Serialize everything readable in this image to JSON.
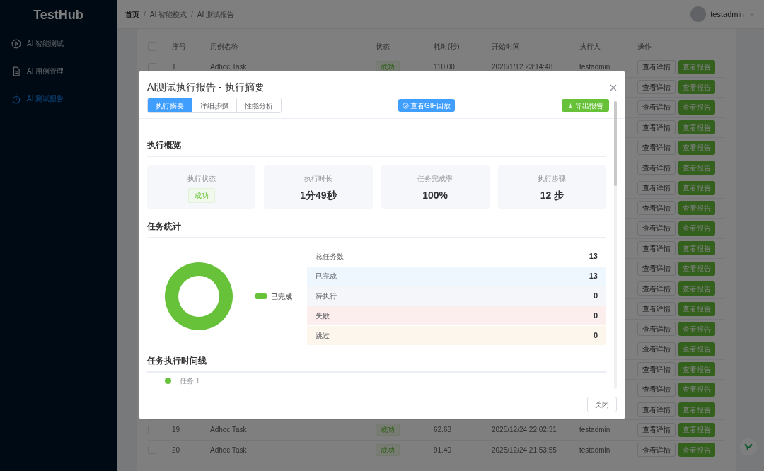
{
  "sidebar": {
    "logo": "TestHub",
    "items": [
      {
        "label": "AI 智能测试",
        "selected": false
      },
      {
        "label": "AI 用例管理",
        "selected": false
      },
      {
        "label": "AI 测试报告",
        "selected": true
      }
    ]
  },
  "header": {
    "breadcrumb": [
      "首页",
      "AI 智能模式",
      "AI 测试报告"
    ],
    "separator": "/",
    "user": "testadmin"
  },
  "table": {
    "all_checked": false,
    "columns": [
      "序号",
      "用例名称",
      "状态",
      "耗时(秒)",
      "开始时间",
      "执行人",
      "操作"
    ],
    "rows": [
      {
        "checked": false,
        "cells": [
          "1",
          "Adhoc Task",
          "成功",
          "110.00",
          "2026/1/12 23:14:48",
          "testadmin"
        ],
        "actions": [
          "查看详情",
          "查看报告"
        ]
      },
      {
        "actions": [
          "查看详情",
          "查看报告"
        ]
      },
      {
        "actions": [
          "查看详情",
          "查看报告"
        ]
      },
      {
        "actions": [
          "查看详情",
          "查看报告"
        ]
      },
      {
        "actions": [
          "查看详情",
          "查看报告"
        ]
      },
      {
        "actions": [
          "查看详情",
          "查看报告"
        ]
      },
      {
        "actions": [
          "查看详情",
          "查看报告"
        ]
      },
      {
        "actions": [
          "查看详情",
          "查看报告"
        ]
      },
      {
        "actions": [
          "查看详情",
          "查看报告"
        ]
      },
      {
        "actions": [
          "查看详情",
          "查看报告"
        ]
      },
      {
        "actions": [
          "查看详情",
          "查看报告"
        ]
      },
      {
        "actions": [
          "查看详情",
          "查看报告"
        ]
      },
      {
        "actions": [
          "查看详情",
          "查看报告"
        ]
      },
      {
        "actions": [
          "查看详情",
          "查看报告"
        ]
      },
      {
        "actions": [
          "查看详情",
          "查看报告"
        ]
      },
      {
        "actions": [
          "查看详情",
          "查看报告"
        ]
      },
      {
        "actions": [
          "查看详情",
          "查看报告"
        ]
      },
      {
        "actions": [
          "查看详情",
          "查看报告"
        ]
      },
      {
        "checked": false,
        "cells": [
          "19",
          "Adhoc Task",
          "成功",
          "62.68",
          "2025/12/24 22:02:31",
          "testadmin"
        ],
        "actions": [
          "查看详情",
          "查看报告"
        ]
      },
      {
        "checked": false,
        "cells": [
          "20",
          "Adhoc Task",
          "成功",
          "91.40",
          "2025/12/24 21:53:55",
          "testadmin"
        ],
        "actions": [
          "查看详情",
          "查看报告"
        ]
      }
    ]
  },
  "dialog": {
    "title": "AI测试执行报告 - 执行摘要",
    "tabs": [
      {
        "label": "执行摘要",
        "selected": true
      },
      {
        "label": "详细步骤",
        "selected": false
      },
      {
        "label": "性能分析",
        "selected": false
      }
    ],
    "gif_button": "查看GIF回放",
    "export_button": "导出报告",
    "overview": {
      "title": "执行概览",
      "cards": [
        {
          "label": "执行状态",
          "kind": "tag",
          "value": "成功"
        },
        {
          "label": "执行时长",
          "kind": "text",
          "value": "1分49秒"
        },
        {
          "label": "任务完成率",
          "kind": "text",
          "value": "100%"
        },
        {
          "label": "执行步骤",
          "kind": "text",
          "value": "12 步"
        }
      ]
    },
    "stats": {
      "title": "任务统计",
      "legend": [
        "已完成"
      ],
      "rows": [
        {
          "label": "总任务数",
          "value": "13",
          "color": "#ffffff"
        },
        {
          "label": "已完成",
          "value": "13",
          "color": "#eef6fe"
        },
        {
          "label": "待执行",
          "value": "0",
          "color": "#f4f6f9"
        },
        {
          "label": "失败",
          "value": "0",
          "color": "#fdeeee"
        },
        {
          "label": "跳过",
          "value": "0",
          "color": "#fdf6ec"
        }
      ]
    },
    "timeline": {
      "title": "任务执行时间线",
      "items": [
        "任务 1"
      ]
    },
    "close_button": "关闭"
  }
}
